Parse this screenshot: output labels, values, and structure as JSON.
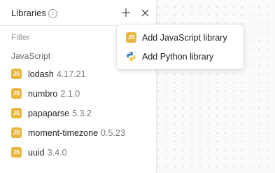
{
  "panel": {
    "title": "Libraries",
    "info_icon": "info-icon",
    "add_icon": "plus-icon",
    "close_icon": "close-icon",
    "filter_placeholder": "Filter",
    "section_label": "JavaScript",
    "libraries": [
      {
        "badge": "JS",
        "name": "lodash",
        "version": "4.17.21"
      },
      {
        "badge": "JS",
        "name": "numbro",
        "version": "2.1.0"
      },
      {
        "badge": "JS",
        "name": "papaparse",
        "version": "5.3.2"
      },
      {
        "badge": "JS",
        "name": "moment-timezone",
        "version": "0.5.23"
      },
      {
        "badge": "JS",
        "name": "uuid",
        "version": "3.4.0"
      }
    ]
  },
  "popup": {
    "items": [
      {
        "icon": "javascript-icon",
        "badge": "JS",
        "label": "Add JavaScript library"
      },
      {
        "icon": "python-icon",
        "label": "Add Python library"
      }
    ]
  },
  "colors": {
    "js_badge": "#e8b740",
    "python_blue": "#3d7ab3",
    "python_yellow": "#f5c93b",
    "canvas_dots": "#d8d8d8"
  }
}
